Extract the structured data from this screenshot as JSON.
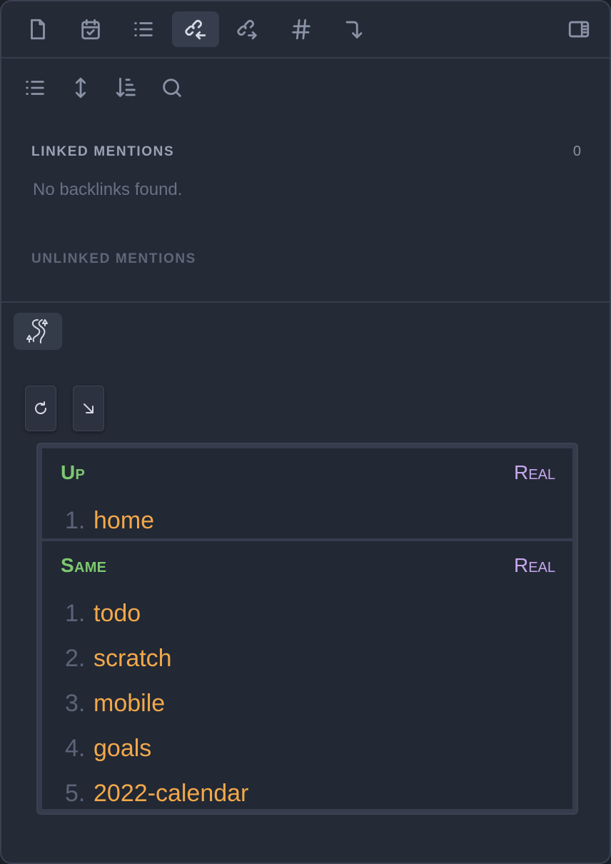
{
  "tabs": [
    {
      "name": "files-tab",
      "icon": "file-icon",
      "active": false
    },
    {
      "name": "calendar-tab",
      "icon": "calendar-check-icon",
      "active": false
    },
    {
      "name": "outline-tab",
      "icon": "list-icon",
      "active": false
    },
    {
      "name": "backlinks-tab",
      "icon": "link-incoming-icon",
      "active": true
    },
    {
      "name": "outgoing-links-tab",
      "icon": "link-outgoing-icon",
      "active": false
    },
    {
      "name": "tags-tab",
      "icon": "hash-icon",
      "active": false
    },
    {
      "name": "breadcrumbs-tab",
      "icon": "corner-down-icon",
      "active": false
    }
  ],
  "backlinks": {
    "linked": {
      "title": "LINKED MENTIONS",
      "count": "0",
      "empty": "No backlinks found."
    },
    "unlinked": {
      "title": "UNLINKED MENTIONS"
    }
  },
  "matrix": {
    "up": {
      "title": "Up",
      "kind": "Real",
      "items": [
        {
          "num": "1.",
          "label": "home"
        }
      ]
    },
    "same": {
      "title": "Same",
      "kind": "Real",
      "items": [
        {
          "num": "1.",
          "label": "todo"
        },
        {
          "num": "2.",
          "label": "scratch"
        },
        {
          "num": "3.",
          "label": "mobile"
        },
        {
          "num": "4.",
          "label": "goals"
        },
        {
          "num": "5.",
          "label": "2022-calendar"
        }
      ]
    }
  },
  "colors": {
    "background": "#242a36",
    "heading_green": "#7ec870",
    "kind_purple": "#c8a8f0",
    "link_orange": "#f2a84a"
  }
}
